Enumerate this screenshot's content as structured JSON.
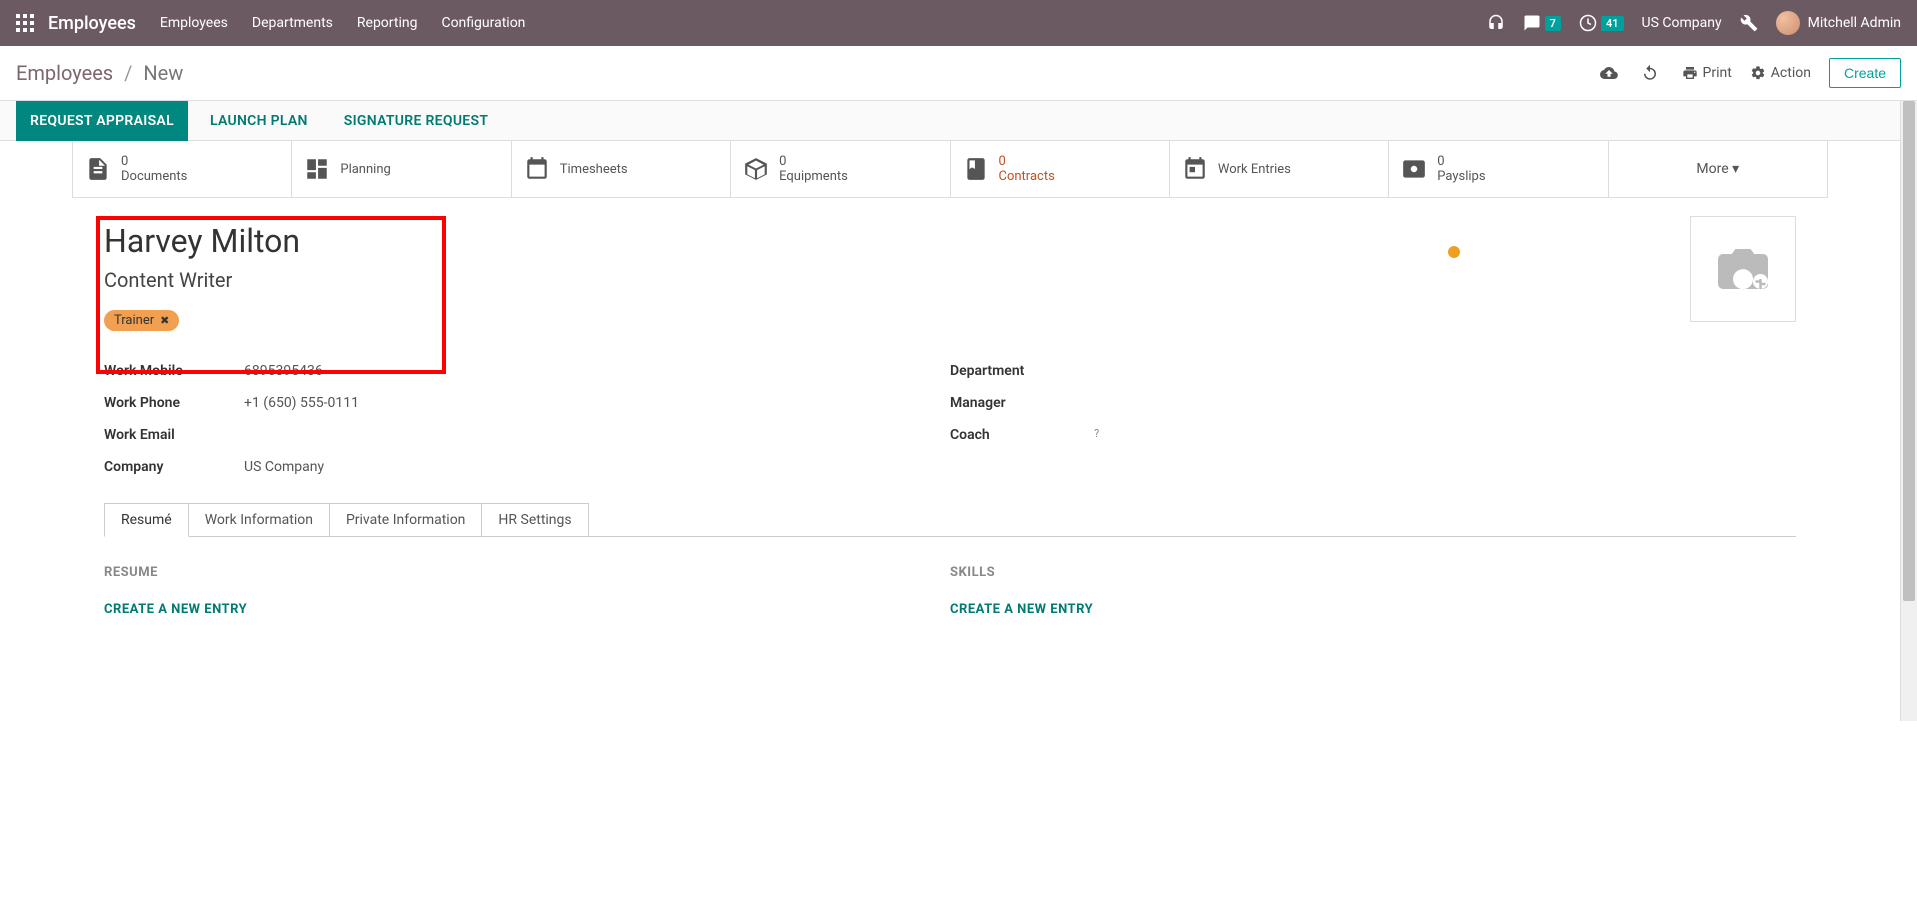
{
  "topbar": {
    "brand": "Employees",
    "nav": [
      "Employees",
      "Departments",
      "Reporting",
      "Configuration"
    ],
    "chat_badge": "7",
    "clock_badge": "41",
    "company": "US Company",
    "user": "Mitchell Admin"
  },
  "control": {
    "breadcrumb_root": "Employees",
    "breadcrumb_current": "New",
    "print": "Print",
    "action": "Action",
    "create": "Create"
  },
  "actions": {
    "request_appraisal": "REQUEST APPRAISAL",
    "launch_plan": "LAUNCH PLAN",
    "signature_request": "SIGNATURE REQUEST"
  },
  "stats": {
    "documents": {
      "count": "0",
      "label": "Documents"
    },
    "planning": {
      "label": "Planning"
    },
    "timesheets": {
      "label": "Timesheets"
    },
    "equipments": {
      "count": "0",
      "label": "Equipments"
    },
    "contracts": {
      "count": "0",
      "label": "Contracts"
    },
    "work_entries": {
      "label": "Work Entries"
    },
    "payslips": {
      "count": "0",
      "label": "Payslips"
    },
    "more": "More"
  },
  "employee": {
    "name": "Harvey Milton",
    "job_title": "Content Writer",
    "tag": "Trainer"
  },
  "fields_left": {
    "work_mobile": {
      "label": "Work Mobile",
      "value": "6895395436"
    },
    "work_phone": {
      "label": "Work Phone",
      "value": "+1 (650) 555-0111"
    },
    "work_email": {
      "label": "Work Email",
      "value": ""
    },
    "company": {
      "label": "Company",
      "value": "US Company"
    }
  },
  "fields_right": {
    "department": {
      "label": "Department",
      "value": ""
    },
    "manager": {
      "label": "Manager",
      "value": ""
    },
    "coach": {
      "label": "Coach",
      "value": ""
    }
  },
  "tabs": [
    "Resumé",
    "Work Information",
    "Private Information",
    "HR Settings"
  ],
  "sections": {
    "resume": {
      "title": "RESUME",
      "action": "CREATE A NEW ENTRY"
    },
    "skills": {
      "title": "SKILLS",
      "action": "CREATE A NEW ENTRY"
    }
  }
}
